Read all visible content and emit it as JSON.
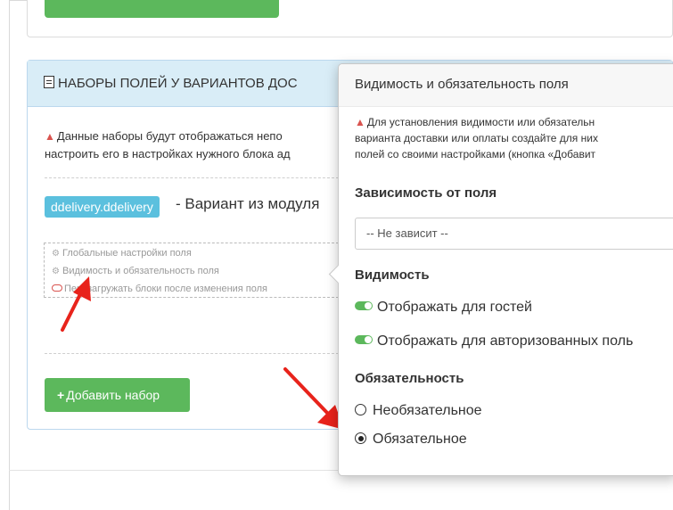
{
  "panel": {
    "heading": "НАБОРЫ ПОЛЕЙ У ВАРИАНТОВ ДОС",
    "notice_line1": "Данные наборы будут отображаться непо",
    "notice_line2": "настроить его в настройках нужного блока ад",
    "variant_badge": "ddelivery.ddelivery",
    "variant_text": "- Вариант из модуля",
    "field_rows": [
      {
        "icon": "cogs-icon",
        "label": "Глобальные настройки поля"
      },
      {
        "icon": "gear-icon",
        "label": "Видимость и обязательность поля"
      },
      {
        "icon": "toggle-off-icon",
        "label": "Перезагружать блоки после изменения поля"
      }
    ],
    "add_button": "Добавить набор"
  },
  "popover": {
    "title": "Видимость и обязательность поля",
    "note_line1": "Для установления видимости или обязательн",
    "note_line2": "варианта доставки или оплаты создайте для них",
    "note_line3": "полей со своими настройками (кнопка «Добавит",
    "dependency_heading": "Зависимость от поля",
    "dependency_select": "-- Не зависит --",
    "visibility_heading": "Видимость",
    "visibility_options": [
      "Отображать для гостей",
      "Отображать для авторизованных поль"
    ],
    "required_heading": "Обязательность",
    "required_options": [
      "Необязательное",
      "Обязательное"
    ],
    "required_selected": "Обязательное"
  },
  "colors": {
    "accent_green": "#5cb85c",
    "info_blue": "#d9edf7",
    "badge_blue": "#5bc0de",
    "warning_red": "#d9534f",
    "arrow_red": "#e8231b"
  }
}
